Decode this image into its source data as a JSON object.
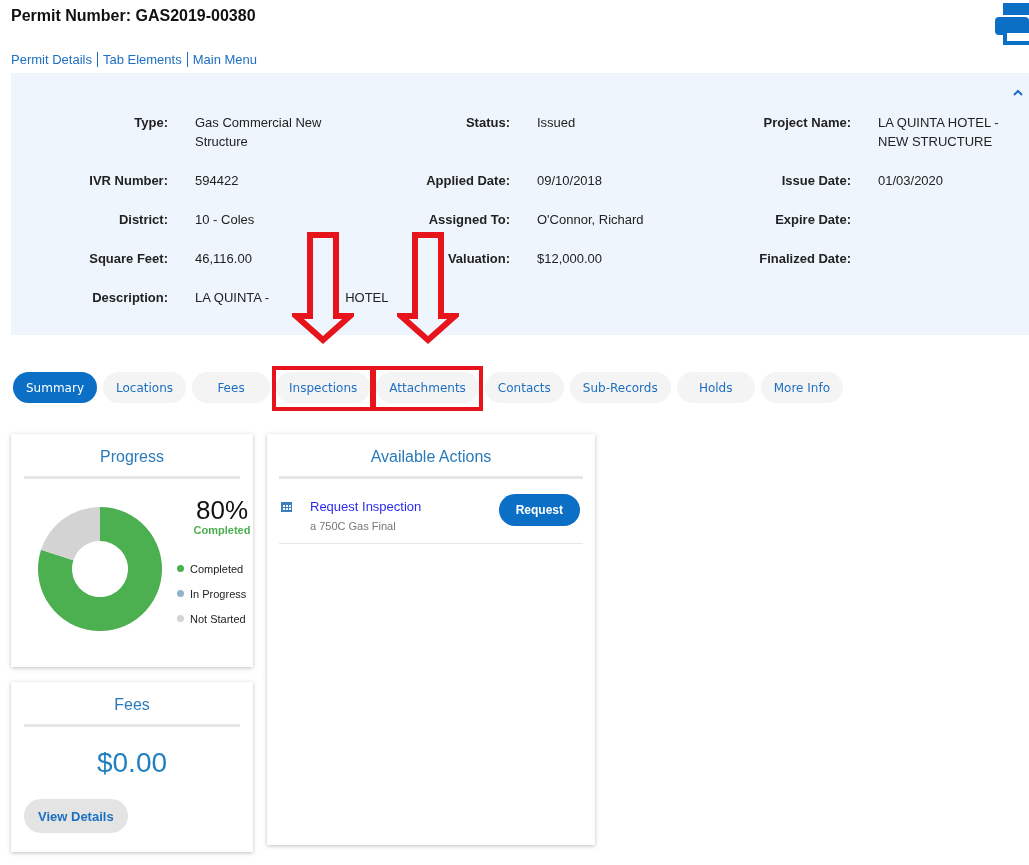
{
  "permit_title": "Permit Number: GAS2019-00380",
  "nav_links": [
    "Permit Details",
    "Tab Elements",
    "Main Menu"
  ],
  "details": {
    "expanded": true,
    "fields": [
      {
        "label": "Type:",
        "value": "Gas Commercial New Structure"
      },
      {
        "label": "Status:",
        "value": "Issued"
      },
      {
        "label": "Project Name:",
        "value": "LA QUINTA HOTEL - NEW STRUCTURE"
      },
      {
        "label": "IVR Number:",
        "value": "594422"
      },
      {
        "label": "Applied Date:",
        "value": "09/10/2018"
      },
      {
        "label": "Issue Date:",
        "value": "01/03/2020"
      },
      {
        "label": "District:",
        "value": "10 - Coles"
      },
      {
        "label": "Assigned To:",
        "value": "O'Connor, Richard"
      },
      {
        "label": "Expire Date:"
      },
      {
        "label": "Square Feet:",
        "value": "46,116.00"
      },
      {
        "label": "Valuation:",
        "value": "$12,000.00"
      },
      {
        "label": "Finalized Date:"
      },
      {
        "label": "Description:",
        "value_parts": [
          "LA QUINTA -",
          "HOTEL"
        ]
      }
    ]
  },
  "tabs": [
    {
      "label": "Summary",
      "selected": true,
      "highlighted": false
    },
    {
      "label": "Locations",
      "selected": false,
      "highlighted": false
    },
    {
      "label": "Fees",
      "selected": false,
      "highlighted": false
    },
    {
      "label": "Inspections",
      "selected": false,
      "highlighted": true
    },
    {
      "label": "Attachments",
      "selected": false,
      "highlighted": true
    },
    {
      "label": "Contacts",
      "selected": false,
      "highlighted": false
    },
    {
      "label": "Sub-Records",
      "selected": false,
      "highlighted": false
    },
    {
      "label": "Holds",
      "selected": false,
      "highlighted": false
    },
    {
      "label": "More Info",
      "selected": false,
      "highlighted": false
    }
  ],
  "progress": {
    "title": "Progress",
    "percent": "80%",
    "caption": "Completed",
    "legend": [
      {
        "color": "#4caf50"
      },
      {
        "color": "#8fb3cb"
      },
      {
        "color": "#d3d3d3"
      }
    ],
    "chart_data": {
      "type": "donut",
      "categories": [
        "Completed",
        "In Progress",
        "Not Started"
      ],
      "values": [
        80,
        0,
        20
      ]
    }
  },
  "actions": {
    "title": "Available Actions",
    "items": [
      {
        "title": "Request Inspection",
        "subtitle": "a 750C Gas Final",
        "button": "Request"
      }
    ]
  },
  "fees": {
    "title": "Fees",
    "amount": "$0.00",
    "button": "View Details"
  }
}
